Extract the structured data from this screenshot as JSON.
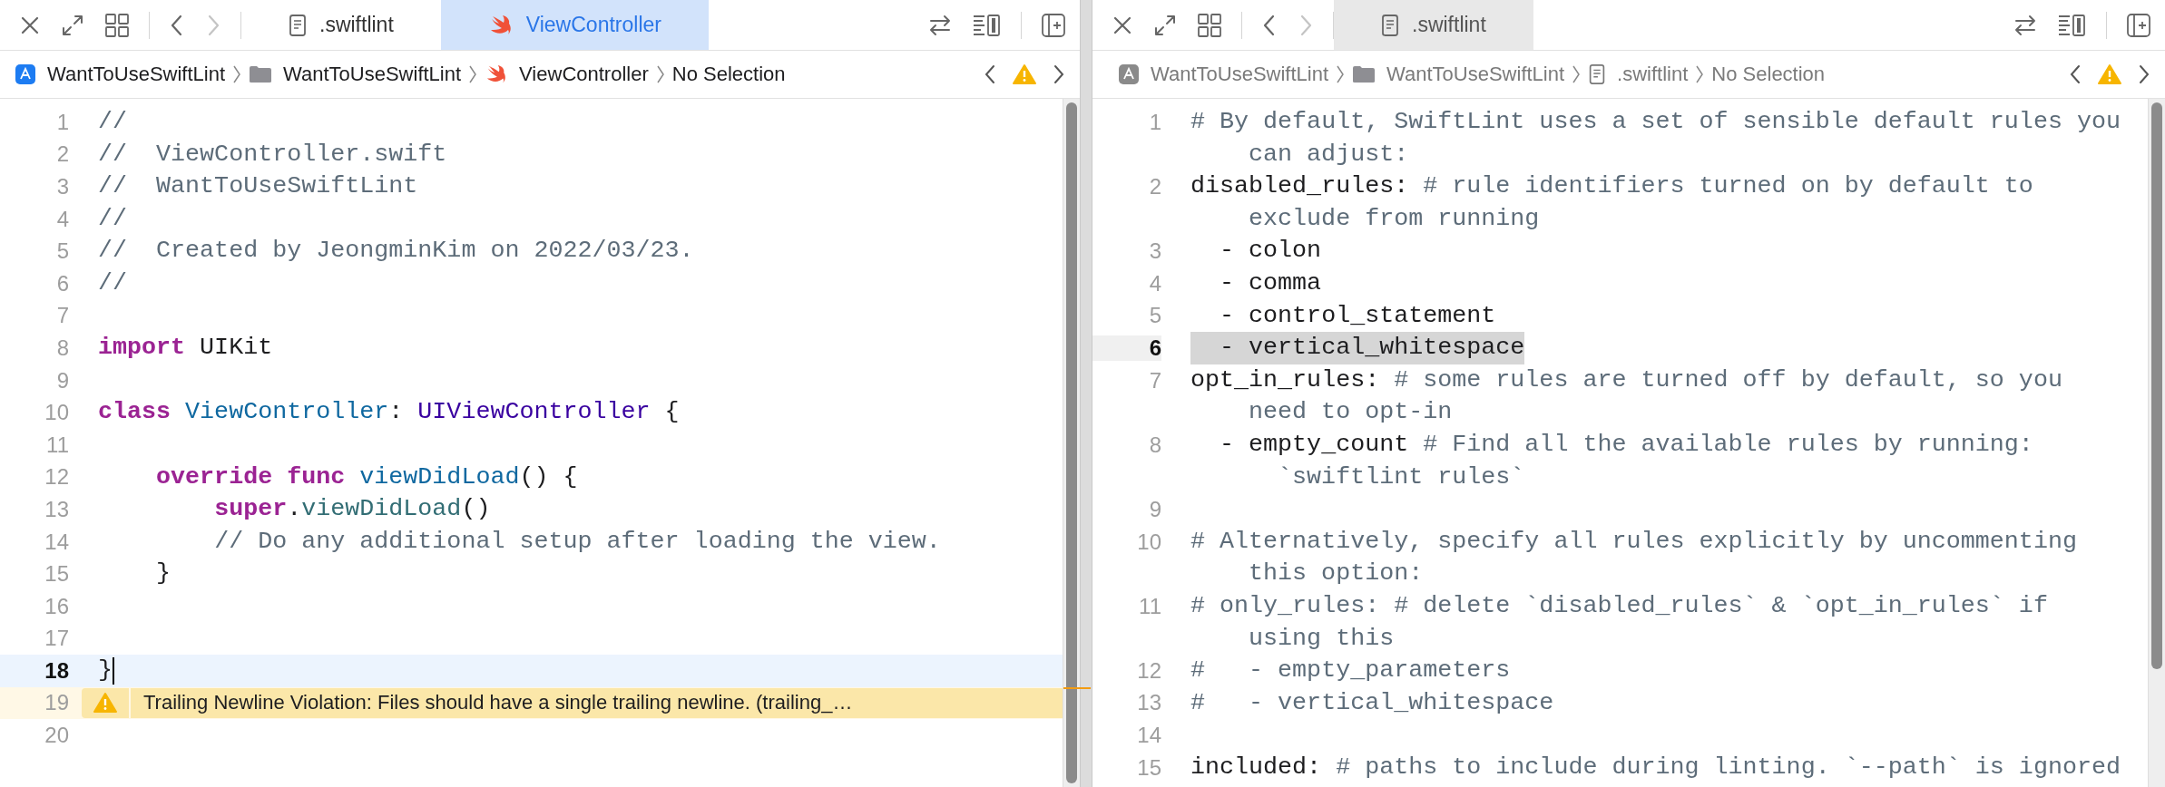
{
  "panes": [
    {
      "active": true,
      "tabs": [
        {
          "label": ".swiftlint",
          "kind": "doc",
          "selected": false
        },
        {
          "label": "ViewController",
          "kind": "swift",
          "selected": true
        }
      ],
      "breadcrumb": [
        {
          "label": "WantToUseSwiftLint",
          "kind": "app"
        },
        {
          "label": "WantToUseSwiftLint",
          "kind": "folder"
        },
        {
          "label": "ViewController",
          "kind": "swift"
        },
        {
          "label": "No Selection",
          "kind": "none"
        }
      ],
      "lines": [
        {
          "number": "1",
          "current": false,
          "selected": false,
          "rows": [
            [
              {
                "kind": "comment",
                "text": "//"
              }
            ]
          ]
        },
        {
          "number": "2",
          "current": false,
          "selected": false,
          "rows": [
            [
              {
                "kind": "comment",
                "text": "//  ViewController.swift"
              }
            ]
          ]
        },
        {
          "number": "3",
          "current": false,
          "selected": false,
          "rows": [
            [
              {
                "kind": "comment",
                "text": "//  WantToUseSwiftLint"
              }
            ]
          ]
        },
        {
          "number": "4",
          "current": false,
          "selected": false,
          "rows": [
            [
              {
                "kind": "comment",
                "text": "//"
              }
            ]
          ]
        },
        {
          "number": "5",
          "current": false,
          "selected": false,
          "rows": [
            [
              {
                "kind": "comment",
                "text": "//  Created by JeongminKim on 2022/03/23."
              }
            ]
          ]
        },
        {
          "number": "6",
          "current": false,
          "selected": false,
          "rows": [
            [
              {
                "kind": "comment",
                "text": "//"
              }
            ]
          ]
        },
        {
          "number": "7",
          "current": false,
          "selected": false
        },
        {
          "number": "8",
          "current": false,
          "selected": false,
          "rows": [
            [
              {
                "kind": "keyword",
                "text": "import"
              },
              {
                "kind": "plain",
                "text": " UIKit"
              }
            ]
          ]
        },
        {
          "number": "9",
          "current": false,
          "selected": false
        },
        {
          "number": "10",
          "current": false,
          "selected": false,
          "rows": [
            [
              {
                "kind": "keyword",
                "text": "class"
              },
              {
                "kind": "plain",
                "text": " "
              },
              {
                "kind": "decl",
                "text": "ViewController"
              },
              {
                "kind": "plain",
                "text": ": "
              },
              {
                "kind": "type",
                "text": "UIViewController"
              },
              {
                "kind": "plain",
                "text": " {"
              }
            ]
          ]
        },
        {
          "number": "11",
          "current": false,
          "selected": false
        },
        {
          "number": "12",
          "current": false,
          "selected": false,
          "rows": [
            [
              {
                "kind": "plain",
                "text": "    "
              },
              {
                "kind": "keyword",
                "text": "override"
              },
              {
                "kind": "plain",
                "text": " "
              },
              {
                "kind": "keyword",
                "text": "func"
              },
              {
                "kind": "plain",
                "text": " "
              },
              {
                "kind": "decl",
                "text": "viewDidLoad"
              },
              {
                "kind": "plain",
                "text": "() {"
              }
            ]
          ]
        },
        {
          "number": "13",
          "current": false,
          "selected": false,
          "rows": [
            [
              {
                "kind": "plain",
                "text": "        "
              },
              {
                "kind": "keyword",
                "text": "super"
              },
              {
                "kind": "plain",
                "text": "."
              },
              {
                "kind": "call",
                "text": "viewDidLoad"
              },
              {
                "kind": "plain",
                "text": "()"
              }
            ]
          ]
        },
        {
          "number": "14",
          "current": false,
          "selected": false,
          "rows": [
            [
              {
                "kind": "plain",
                "text": "        "
              },
              {
                "kind": "comment",
                "text": "// Do any additional setup after loading the view."
              }
            ]
          ]
        },
        {
          "number": "15",
          "current": false,
          "selected": false,
          "rows": [
            [
              {
                "kind": "plain",
                "text": "    }"
              }
            ]
          ]
        },
        {
          "number": "16",
          "current": false,
          "selected": false
        },
        {
          "number": "17",
          "current": false,
          "selected": false
        },
        {
          "number": "18",
          "current": true,
          "selected": false,
          "rows": [
            [
              {
                "kind": "plain",
                "text": "}"
              }
            ]
          ]
        },
        {
          "number": "19",
          "current": false,
          "selected": false,
          "annotation": "Trailing Newline Violation: Files should have a single trailing newline. (trailing_…"
        },
        {
          "number": "20",
          "current": false,
          "selected": false
        }
      ]
    },
    {
      "active": false,
      "tabs": [
        {
          "label": ".swiftlint",
          "kind": "doc",
          "selected": true
        }
      ],
      "breadcrumb": [
        {
          "label": "WantToUseSwiftLint",
          "kind": "app"
        },
        {
          "label": "WantToUseSwiftLint",
          "kind": "folder"
        },
        {
          "label": ".swiftlint",
          "kind": "doc"
        },
        {
          "label": "No Selection",
          "kind": "none"
        }
      ],
      "lines": [
        {
          "number": "1",
          "current": false,
          "selected": false,
          "rows": [
            [
              {
                "kind": "comment",
                "text": "# By default, SwiftLint uses a set of sensible default rules you"
              }
            ],
            [
              {
                "kind": "comment",
                "text": "can adjust:"
              }
            ]
          ]
        },
        {
          "number": "2",
          "current": false,
          "selected": false,
          "rows": [
            [
              {
                "kind": "plain",
                "text": "disabled_rules:"
              },
              {
                "kind": "comment",
                "text": " # rule identifiers turned on by default to"
              }
            ],
            [
              {
                "kind": "comment",
                "text": "exclude from running"
              }
            ]
          ]
        },
        {
          "number": "3",
          "current": false,
          "selected": false,
          "rows": [
            [
              {
                "kind": "plain",
                "text": "  - colon"
              }
            ]
          ]
        },
        {
          "number": "4",
          "current": false,
          "selected": false,
          "rows": [
            [
              {
                "kind": "plain",
                "text": "  - comma"
              }
            ]
          ]
        },
        {
          "number": "5",
          "current": false,
          "selected": false,
          "rows": [
            [
              {
                "kind": "plain",
                "text": "  - control_statement"
              }
            ]
          ]
        },
        {
          "number": "6",
          "current": true,
          "selected": true,
          "rows": [
            [
              {
                "kind": "plain",
                "text": "  - vertical_whitespace"
              }
            ]
          ]
        },
        {
          "number": "7",
          "current": false,
          "selected": false,
          "rows": [
            [
              {
                "kind": "plain",
                "text": "opt_in_rules:"
              },
              {
                "kind": "comment",
                "text": " # some rules are turned off by default, so you"
              }
            ],
            [
              {
                "kind": "comment",
                "text": "need to opt-in"
              }
            ]
          ]
        },
        {
          "number": "8",
          "current": false,
          "selected": false,
          "rows": [
            [
              {
                "kind": "plain",
                "text": "  - empty_count"
              },
              {
                "kind": "comment",
                "text": " # Find all the available rules by running:"
              }
            ],
            [
              {
                "kind": "comment",
                "text": "`swiftlint rules`"
              }
            ]
          ]
        },
        {
          "number": "9",
          "current": false,
          "selected": false
        },
        {
          "number": "10",
          "current": false,
          "selected": false,
          "rows": [
            [
              {
                "kind": "comment",
                "text": "# Alternatively, specify all rules explicitly by uncommenting"
              }
            ],
            [
              {
                "kind": "comment",
                "text": "this option:"
              }
            ]
          ]
        },
        {
          "number": "11",
          "current": false,
          "selected": false,
          "rows": [
            [
              {
                "kind": "comment",
                "text": "# only_rules: # delete `disabled_rules` & `opt_in_rules` if"
              }
            ],
            [
              {
                "kind": "comment",
                "text": "using this"
              }
            ]
          ]
        },
        {
          "number": "12",
          "current": false,
          "selected": false,
          "rows": [
            [
              {
                "kind": "comment",
                "text": "#   - empty_parameters"
              }
            ]
          ]
        },
        {
          "number": "13",
          "current": false,
          "selected": false,
          "rows": [
            [
              {
                "kind": "comment",
                "text": "#   - vertical_whitespace"
              }
            ]
          ]
        },
        {
          "number": "14",
          "current": false,
          "selected": false
        },
        {
          "number": "15",
          "current": false,
          "selected": false,
          "rows": [
            [
              {
                "kind": "plain",
                "text": "included:"
              },
              {
                "kind": "comment",
                "text": " # paths to include during linting. `--path` is ignored"
              }
            ]
          ]
        }
      ]
    }
  ]
}
